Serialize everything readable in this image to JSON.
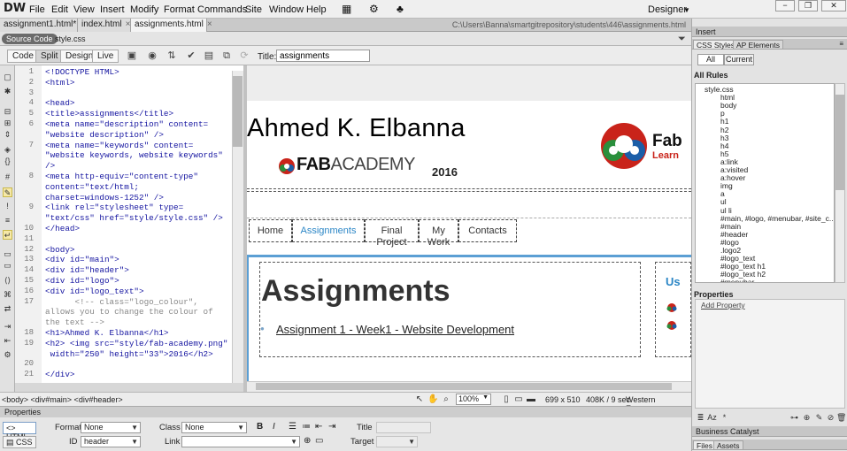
{
  "app": {
    "logo": "DW",
    "workspace": "Designer"
  },
  "menu": [
    "File",
    "Edit",
    "View",
    "Insert",
    "Modify",
    "Format",
    "Commands",
    "Site",
    "Window",
    "Help"
  ],
  "window_controls": {
    "minimize": "−",
    "restore": "❐",
    "close": "✕"
  },
  "doc_tabs": [
    {
      "label": "assignment1.html*",
      "active": false
    },
    {
      "label": "index.html",
      "active": false
    },
    {
      "label": "assignments.html",
      "active": true
    }
  ],
  "doc_path": "C:\\Users\\Banna\\smartgitrepository\\students\\446\\assignments.html",
  "source_bar": {
    "source_code": "Source Code",
    "file": "style.css"
  },
  "toolbar": {
    "code": "Code",
    "split": "Split",
    "design": "Design",
    "live": "Live",
    "title_label": "Title:",
    "title_value": "assignments"
  },
  "code_lines": [
    {
      "n": "1",
      "text": "<!DOCTYPE HTML>",
      "kind": "tag"
    },
    {
      "n": "2",
      "text": "<html>",
      "kind": "tag"
    },
    {
      "n": "3",
      "text": "",
      "kind": "tag"
    },
    {
      "n": "4",
      "text": "<head>",
      "kind": "tag"
    },
    {
      "n": "5",
      "text": "<title>assignments</title>",
      "kind": "tag"
    },
    {
      "n": "6",
      "text": "<meta name=\"description\" content=",
      "kind": "tag"
    },
    {
      "n": "",
      "text": "\"website description\" />",
      "kind": "tag"
    },
    {
      "n": "7",
      "text": "<meta name=\"keywords\" content=",
      "kind": "tag"
    },
    {
      "n": "",
      "text": "\"website keywords, website keywords\"",
      "kind": "tag"
    },
    {
      "n": "",
      "text": "/>",
      "kind": "tag"
    },
    {
      "n": "8",
      "text": "<meta http-equiv=\"content-type\"",
      "kind": "tag"
    },
    {
      "n": "",
      "text": "content=\"text/html;",
      "kind": "tag"
    },
    {
      "n": "",
      "text": "charset=windows-1252\" />",
      "kind": "tag"
    },
    {
      "n": "9",
      "text": "<link rel=\"stylesheet\" type=",
      "kind": "tag"
    },
    {
      "n": "",
      "text": "\"text/css\" href=\"style/style.css\" />",
      "kind": "tag"
    },
    {
      "n": "10",
      "text": "</head>",
      "kind": "tag"
    },
    {
      "n": "11",
      "text": "",
      "kind": "tag"
    },
    {
      "n": "12",
      "text": "<body>",
      "kind": "tag"
    },
    {
      "n": "13",
      "text": "<div id=\"main\">",
      "kind": "tag"
    },
    {
      "n": "14",
      "text": "<div id=\"header\">",
      "kind": "tag"
    },
    {
      "n": "15",
      "text": "<div id=\"logo\">",
      "kind": "tag"
    },
    {
      "n": "16",
      "text": "<div id=\"logo_text\">",
      "kind": "tag"
    },
    {
      "n": "17",
      "text": "      <!-- class=\"logo_colour\",",
      "kind": "cmt"
    },
    {
      "n": "",
      "text": "allows you to change the colour of",
      "kind": "cmt"
    },
    {
      "n": "",
      "text": "the text -->",
      "kind": "cmt"
    },
    {
      "n": "18",
      "text": "<h1>Ahmed K. Elbanna</h1>",
      "kind": "tag"
    },
    {
      "n": "19",
      "text": "<h2> <img src=\"style/fab-academy.png\"",
      "kind": "tag"
    },
    {
      "n": "",
      "text": " width=\"250\" height=\"33\">2016</h2>",
      "kind": "tag"
    },
    {
      "n": "20",
      "text": "",
      "kind": "tag"
    },
    {
      "n": "21",
      "text": "</div>",
      "kind": "tag"
    }
  ],
  "design": {
    "name": "Ahmed K. Elbanna",
    "fab_bold": "FAB",
    "fab_light": "ACADEMY",
    "year": "2016",
    "fab_right": "Fab",
    "learn": "Learn",
    "nav": [
      {
        "label": "Home",
        "active": false
      },
      {
        "label": "Assignments",
        "active": true
      },
      {
        "label": "Final Project",
        "active": false
      },
      {
        "label": "My Work",
        "active": false
      },
      {
        "label": "Contacts",
        "active": false
      }
    ],
    "heading": "Assignments",
    "link": "Assignment 1 - Week1 - Website Development",
    "side_heading": "Us"
  },
  "status": {
    "tags": "<body> <div#main> <div#header>",
    "zoom": "100%",
    "size": "699 x 510",
    "kb": "408K / 9 sec",
    "encoding": "Western European"
  },
  "properties": {
    "title": "Properties",
    "html_btn": "HTML",
    "css_btn": "CSS",
    "format_label": "Format",
    "format_value": "None",
    "class_label": "Class",
    "class_value": "None",
    "id_label": "ID",
    "id_value": "header",
    "link_label": "Link",
    "title_label": "Title",
    "target_label": "Target",
    "bold": "B",
    "italic": "I"
  },
  "right_panel": {
    "insert": "Insert",
    "css_styles": "CSS Styles",
    "ap_elements": "AP Elements",
    "all": "All",
    "current": "Current",
    "all_rules": "All Rules",
    "rules": [
      "style.css",
      "html",
      "body",
      "p",
      "h1",
      "h2",
      "h3",
      "h4",
      "h5",
      "a:link",
      "a:visited",
      "a:hover",
      "img",
      "a",
      "ul",
      "ul li",
      "#main, #logo, #menubar, #site_c...",
      "#main",
      "#header",
      "#logo",
      ".logo2",
      "#logo_text",
      "#logo_text h1",
      "#logo_text h2",
      "#menubar"
    ],
    "properties": "Properties",
    "add_property": "Add Property",
    "business_catalyst": "Business Catalyst",
    "files": "Files",
    "assets": "Assets"
  }
}
